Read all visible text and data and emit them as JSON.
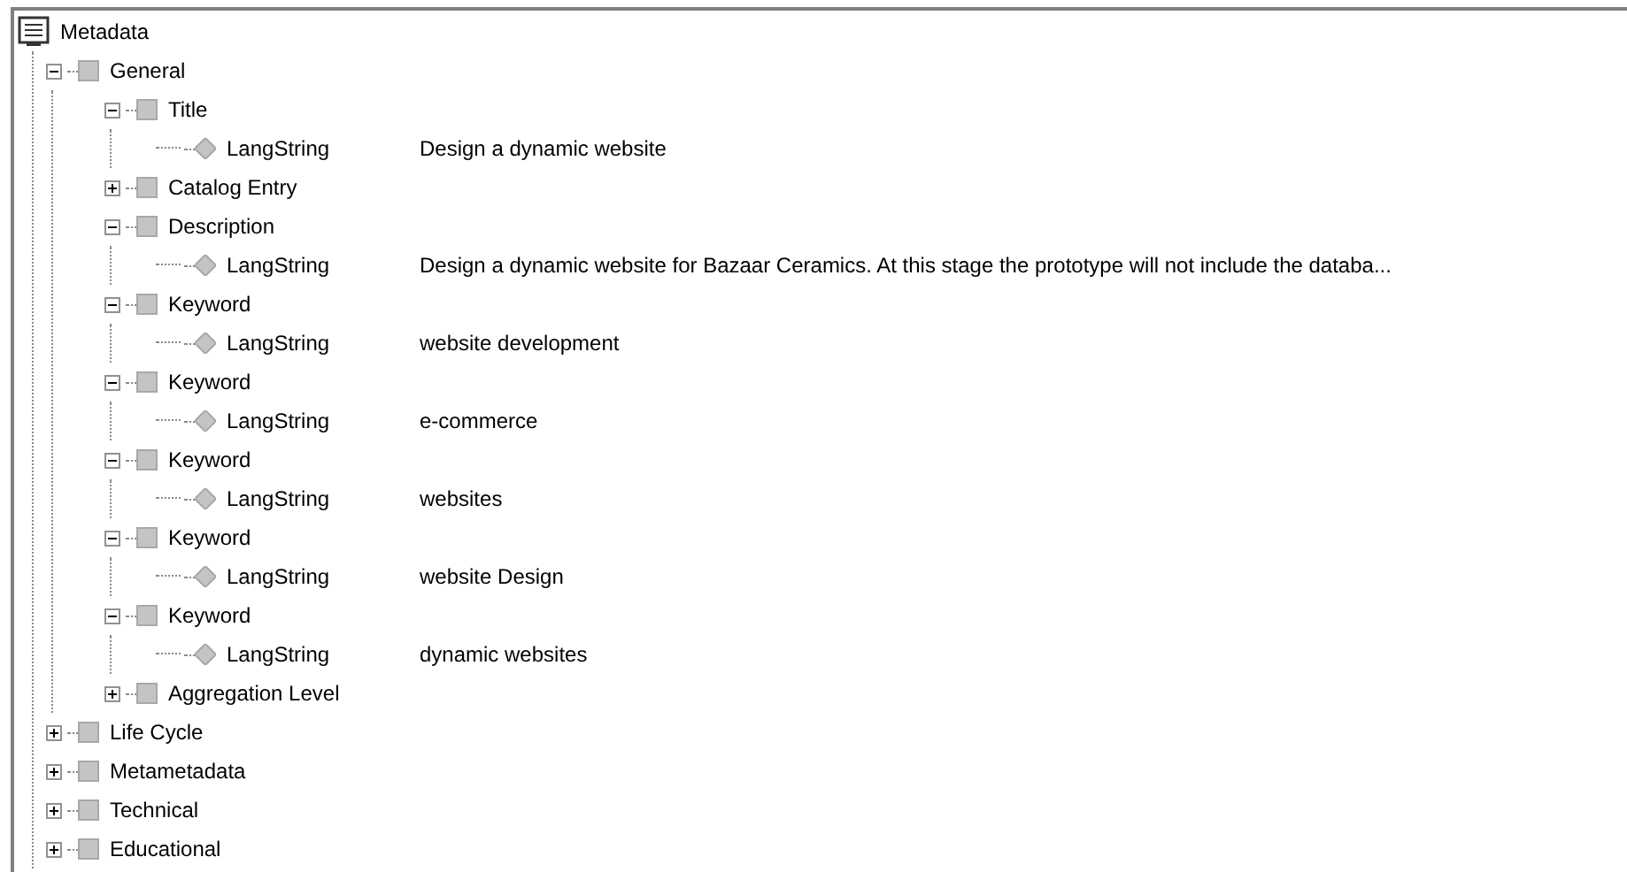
{
  "tree": {
    "label": "Metadata",
    "kind": "root",
    "children": [
      {
        "label": "General",
        "kind": "element",
        "expanded": true,
        "children": [
          {
            "label": "Title",
            "kind": "element",
            "expanded": true,
            "children": [
              {
                "label": "LangString",
                "kind": "leaf",
                "value": "Design a dynamic website"
              }
            ]
          },
          {
            "label": "Catalog Entry",
            "kind": "element",
            "expanded": false
          },
          {
            "label": "Description",
            "kind": "element",
            "expanded": true,
            "children": [
              {
                "label": "LangString",
                "kind": "leaf",
                "value": "Design a dynamic website for Bazaar Ceramics. At this stage the prototype will not include the databa..."
              }
            ]
          },
          {
            "label": "Keyword",
            "kind": "element",
            "expanded": true,
            "children": [
              {
                "label": "LangString",
                "kind": "leaf",
                "value": "website development"
              }
            ]
          },
          {
            "label": "Keyword",
            "kind": "element",
            "expanded": true,
            "children": [
              {
                "label": "LangString",
                "kind": "leaf",
                "value": "e-commerce"
              }
            ]
          },
          {
            "label": "Keyword",
            "kind": "element",
            "expanded": true,
            "children": [
              {
                "label": "LangString",
                "kind": "leaf",
                "value": "websites"
              }
            ]
          },
          {
            "label": "Keyword",
            "kind": "element",
            "expanded": true,
            "children": [
              {
                "label": "LangString",
                "kind": "leaf",
                "value": "website Design"
              }
            ]
          },
          {
            "label": "Keyword",
            "kind": "element",
            "expanded": true,
            "children": [
              {
                "label": "LangString",
                "kind": "leaf",
                "value": "dynamic websites"
              }
            ]
          },
          {
            "label": "Aggregation Level",
            "kind": "element",
            "expanded": false
          }
        ]
      },
      {
        "label": "Life Cycle",
        "kind": "element",
        "expanded": false
      },
      {
        "label": "Metametadata",
        "kind": "element",
        "expanded": false
      },
      {
        "label": "Technical",
        "kind": "element",
        "expanded": false
      },
      {
        "label": "Educational",
        "kind": "element",
        "expanded": false
      }
    ]
  }
}
